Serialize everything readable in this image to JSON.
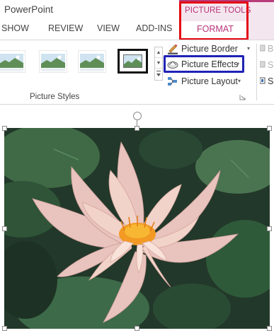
{
  "app": {
    "title": "PowerPoint"
  },
  "contextual_group": {
    "label": "PICTURE TOOLS",
    "accent_color": "#b8337a"
  },
  "tabs": [
    {
      "label": "SHOW"
    },
    {
      "label": "REVIEW"
    },
    {
      "label": "VIEW"
    },
    {
      "label": "ADD-INS"
    },
    {
      "label": "FORMAT",
      "active": true
    }
  ],
  "ribbon": {
    "picture_styles": {
      "group_label": "Picture Styles",
      "thumbnails": [
        {
          "name": "style-1"
        },
        {
          "name": "style-2"
        },
        {
          "name": "style-3"
        },
        {
          "name": "style-4",
          "selected": true
        }
      ]
    },
    "commands": [
      {
        "label": "Picture Border",
        "icon": "pencil-icon"
      },
      {
        "label": "Picture Effects",
        "icon": "effects-icon",
        "highlighted": true
      },
      {
        "label": "Picture Layout",
        "icon": "layout-icon"
      }
    ],
    "cut_off_commands": [
      {
        "label": "Br"
      },
      {
        "label": "Se"
      },
      {
        "label": "Se"
      }
    ]
  },
  "highlights": {
    "picture_tools": "#e30613",
    "picture_effects": "#1f23b5"
  },
  "canvas": {
    "image": "pink water lily photo"
  }
}
